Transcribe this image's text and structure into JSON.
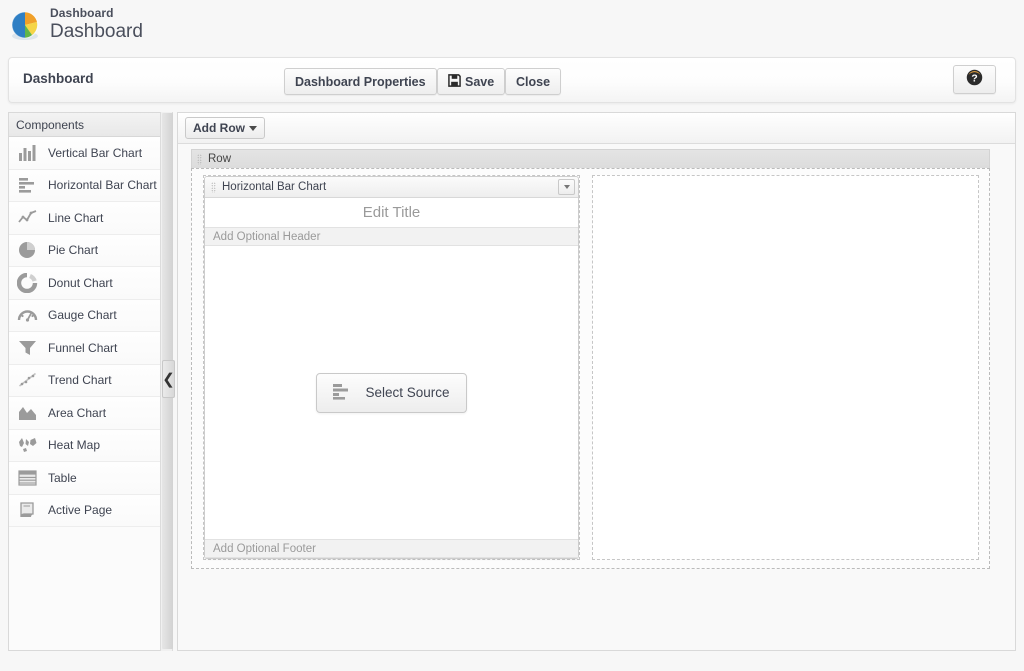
{
  "brand": {
    "logo_icon": "pie-chart-logo",
    "small_title": "Dashboard",
    "large_title": "Dashboard"
  },
  "toolbar": {
    "title": "Dashboard",
    "properties_label": "Dashboard Properties",
    "save_label": "Save",
    "save_icon": "floppy-disk-icon",
    "close_label": "Close",
    "help_icon": "question-mark-icon"
  },
  "sidebar": {
    "header": "Components",
    "collapse_icon": "chevron-left-icon",
    "items": [
      {
        "label": "Vertical Bar Chart",
        "icon": "vertical-bar-chart-icon"
      },
      {
        "label": "Horizontal Bar Chart",
        "icon": "horizontal-bar-chart-icon"
      },
      {
        "label": "Line Chart",
        "icon": "line-chart-icon"
      },
      {
        "label": "Pie Chart",
        "icon": "pie-chart-icon"
      },
      {
        "label": "Donut Chart",
        "icon": "donut-chart-icon"
      },
      {
        "label": "Gauge Chart",
        "icon": "gauge-chart-icon"
      },
      {
        "label": "Funnel Chart",
        "icon": "funnel-chart-icon"
      },
      {
        "label": "Trend Chart",
        "icon": "trend-chart-icon"
      },
      {
        "label": "Area Chart",
        "icon": "area-chart-icon"
      },
      {
        "label": "Heat Map",
        "icon": "heat-map-icon"
      },
      {
        "label": "Table",
        "icon": "table-icon"
      },
      {
        "label": "Active Page",
        "icon": "active-page-icon"
      }
    ]
  },
  "canvas": {
    "add_row_label": "Add Row",
    "add_row_caret": "chevron-down-icon",
    "row": {
      "label": "Row",
      "grip_icon": "drag-handle-icon",
      "panel": {
        "header_label": "Horizontal Bar Chart",
        "grip_icon": "drag-handle-icon",
        "menu_icon": "chevron-down-icon",
        "title_placeholder": "Edit Title",
        "header_placeholder": "Add Optional Header",
        "footer_placeholder": "Add Optional Footer",
        "select_source_label": "Select Source",
        "select_source_icon": "horizontal-bar-chart-icon"
      }
    }
  },
  "colors": {
    "page_bg": "#f7f7f7",
    "panel_border": "#cdcdcd",
    "text": "#3f4451",
    "muted_text": "#9a9a9a",
    "icon_grey": "#9b9b9b"
  }
}
